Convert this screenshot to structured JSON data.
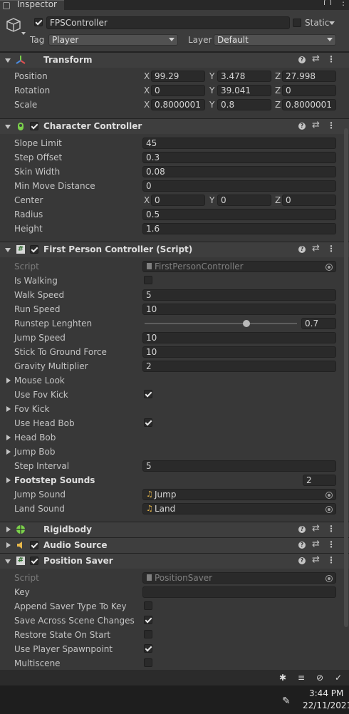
{
  "tab": {
    "title": "Inspector"
  },
  "header": {
    "name": "FPSController",
    "static_label": "Static",
    "tag_label": "Tag",
    "tag_value": "Player",
    "layer_label": "Layer",
    "layer_value": "Default"
  },
  "transform": {
    "title": "Transform",
    "position_label": "Position",
    "rotation_label": "Rotation",
    "scale_label": "Scale",
    "axis_x": "X",
    "axis_y": "Y",
    "axis_z": "Z",
    "position": [
      "99.29",
      "3.478",
      "27.998"
    ],
    "rotation": [
      "0",
      "39.041",
      "0"
    ],
    "scale": [
      "0.8000001",
      "0.8",
      "0.8000001"
    ]
  },
  "character_controller": {
    "title": "Character Controller",
    "slope_limit_label": "Slope Limit",
    "slope_limit": "45",
    "step_offset_label": "Step Offset",
    "step_offset": "0.3",
    "skin_width_label": "Skin Width",
    "skin_width": "0.08",
    "min_move_label": "Min Move Distance",
    "min_move": "0",
    "center_label": "Center",
    "center": [
      "0",
      "0",
      "0"
    ],
    "radius_label": "Radius",
    "radius": "0.5",
    "height_label": "Height",
    "height": "1.6"
  },
  "fps_script": {
    "title": "First Person Controller (Script)",
    "script_label": "Script",
    "script_value": "FirstPersonController",
    "is_walking_label": "Is Walking",
    "walk_speed_label": "Walk Speed",
    "walk_speed": "5",
    "run_speed_label": "Run Speed",
    "run_speed": "10",
    "runstep_label": "Runstep Lenghten",
    "runstep": "0.7",
    "runstep_fraction": 0.7,
    "jump_speed_label": "Jump Speed",
    "jump_speed": "10",
    "stick_label": "Stick To Ground Force",
    "stick": "10",
    "gravity_label": "Gravity Multiplier",
    "gravity": "2",
    "mouse_look_label": "Mouse Look",
    "use_fov_kick_label": "Use Fov Kick",
    "fov_kick_label": "Fov Kick",
    "use_head_bob_label": "Use Head Bob",
    "head_bob_label": "Head Bob",
    "jump_bob_label": "Jump Bob",
    "step_interval_label": "Step Interval",
    "step_interval": "5",
    "footstep_label": "Footstep Sounds",
    "footstep_count": "2",
    "jump_sound_label": "Jump Sound",
    "jump_sound": "Jump",
    "land_sound_label": "Land Sound",
    "land_sound": "Land"
  },
  "rigidbody": {
    "title": "Rigidbody"
  },
  "audio_source": {
    "title": "Audio Source"
  },
  "position_saver": {
    "title": "Position Saver",
    "script_label": "Script",
    "script_value": "PositionSaver",
    "key_label": "Key",
    "key_value": "",
    "append_label": "Append Saver Type To Key",
    "save_across_label": "Save Across Scene Changes",
    "restore_label": "Restore State On Start",
    "use_spawn_label": "Use Player Spawnpoint",
    "multiscene_label": "Multiscene"
  },
  "taskbar": {
    "time": "3:44 PM",
    "date": "22/11/2021"
  },
  "colors": {
    "panel": "#383838",
    "field": "#2a2a2a",
    "header": "#3e3e3e",
    "taskbar": "#1e1e1e"
  }
}
